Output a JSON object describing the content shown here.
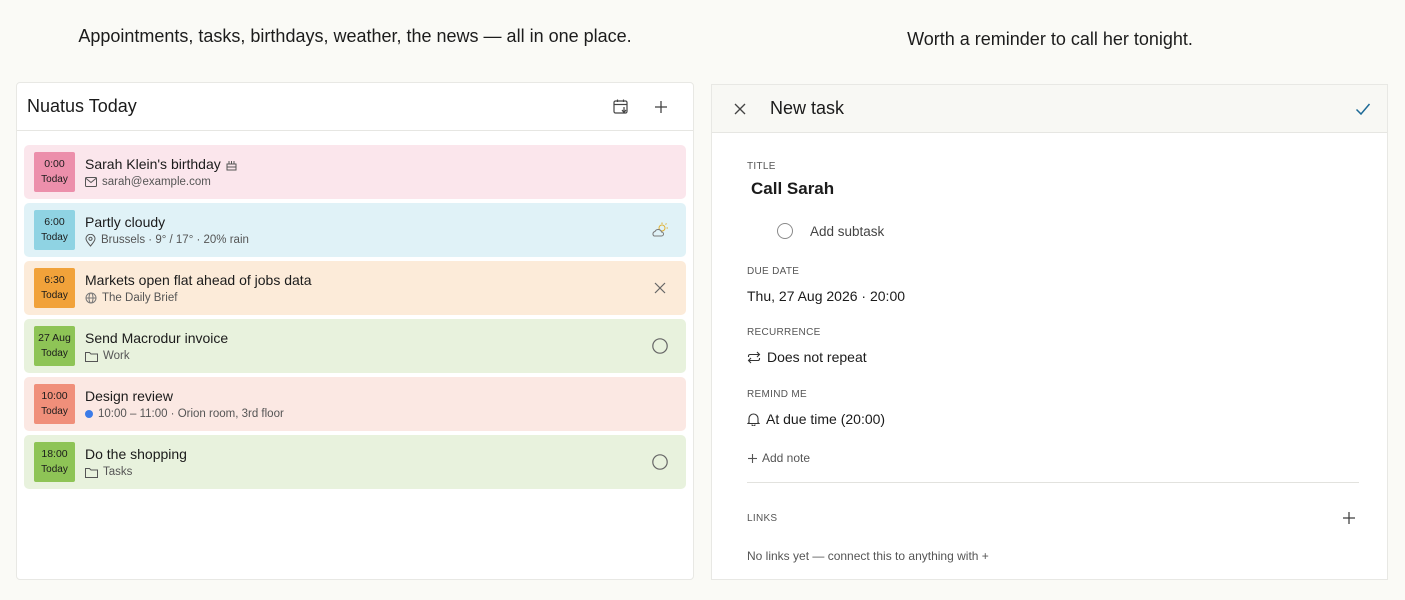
{
  "captions": {
    "left": "Appointments, tasks, birthdays, weather, the news — all in one place.",
    "right": "Worth a reminder to call her tonight."
  },
  "today": {
    "title": "Nuatus Today",
    "items": [
      {
        "time": "0:00",
        "day": "Today",
        "title": "Sarah Klein's birthday",
        "sub": "sarah@example.com",
        "bg": "#fbe6ec",
        "badge": "#ec8fab",
        "sub_icon": "mail-icon",
        "title_icon": "cake-icon",
        "action": ""
      },
      {
        "time": "6:00",
        "day": "Today",
        "title": "Partly cloudy",
        "sub": "Brussels · 9° / 17° · 20% rain",
        "bg": "#e0f2f7",
        "badge": "#8fd3e3",
        "sub_icon": "location-pin-icon",
        "action": "weather-icon"
      },
      {
        "time": "6:30",
        "day": "Today",
        "title": "Markets open flat ahead of jobs data",
        "sub": "The Daily Brief",
        "bg": "#fcebd9",
        "badge": "#f1a23a",
        "sub_icon": "globe-icon",
        "action": "close-icon"
      },
      {
        "time": "27 Aug",
        "day": "Today",
        "title": "Send Macrodur invoice",
        "sub": "Work",
        "bg": "#e8f2dd",
        "badge": "#8ec456",
        "sub_icon": "folder-icon",
        "action": "checkbox-circle-icon"
      },
      {
        "time": "10:00",
        "day": "Today",
        "title": "Design review",
        "sub": "10:00 – 11:00 · Orion room, 3rd floor",
        "bg": "#fbe8e3",
        "badge": "#f08f7a",
        "sub_icon": "calendar-dot-icon",
        "action": ""
      },
      {
        "time": "18:00",
        "day": "Today",
        "title": "Do the shopping",
        "sub": "Tasks",
        "bg": "#e8f2dd",
        "badge": "#8ec456",
        "sub_icon": "folder-icon",
        "action": "checkbox-circle-icon"
      }
    ]
  },
  "task": {
    "header_title": "New task",
    "title_label": "TITLE",
    "title_value": "Call Sarah",
    "subtask_placeholder": "Add subtask",
    "due_label": "DUE DATE",
    "due_value": "Thu, 27 Aug 2026 · 20:00",
    "recurrence_label": "RECURRENCE",
    "recurrence_value": "Does not repeat",
    "remind_label": "REMIND ME",
    "remind_value": "At due time (20:00)",
    "add_note": "Add note",
    "links_label": "LINKS",
    "no_links": "No links yet — connect this to anything with +"
  }
}
